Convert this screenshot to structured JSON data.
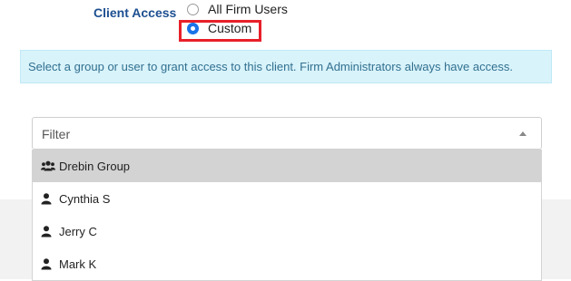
{
  "client_access": {
    "label": "Client Access",
    "options": [
      {
        "label": "All Firm Users",
        "selected": false
      },
      {
        "label": "Custom",
        "selected": true
      }
    ]
  },
  "info_alert": {
    "text": "Select a group or user to grant access to this client. Firm Administrators always have access."
  },
  "filter": {
    "placeholder": "Filter"
  },
  "dropdown": {
    "items": [
      {
        "label": "Drebin Group",
        "icon": "users-group-icon",
        "highlighted": true
      },
      {
        "label": "Cynthia S",
        "icon": "user-icon",
        "highlighted": false
      },
      {
        "label": "Jerry C",
        "icon": "user-icon",
        "highlighted": false
      },
      {
        "label": "Mark K",
        "icon": "user-icon",
        "highlighted": false
      }
    ]
  },
  "colors": {
    "label_blue": "#1d4f91",
    "radio_blue": "#1a73e8",
    "highlight_red": "#e8202a",
    "alert_bg": "#d9f3fb",
    "alert_text": "#31708f",
    "selected_row": "#d3d3d3"
  }
}
